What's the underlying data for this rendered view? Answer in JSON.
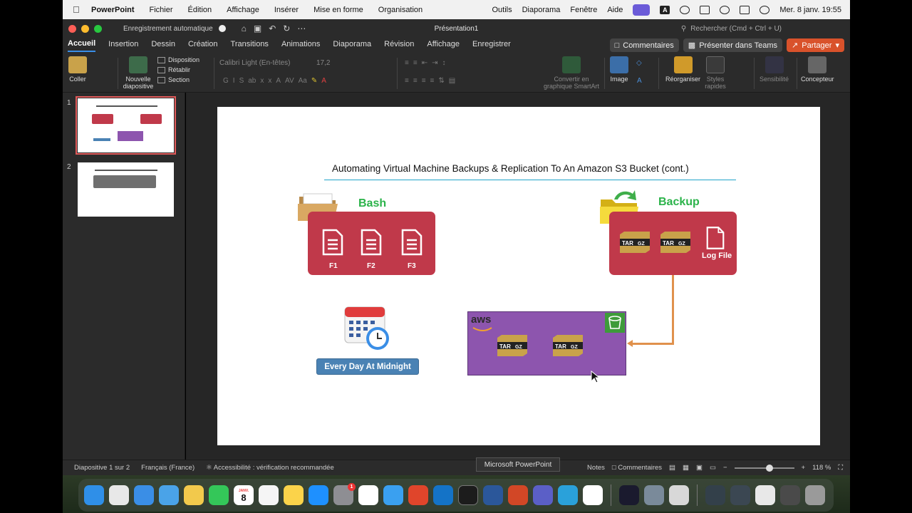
{
  "menubar": {
    "app": "PowerPoint",
    "items": [
      "Fichier",
      "Édition",
      "Affichage",
      "Insérer",
      "Mise en forme",
      "Organisation",
      "Outils",
      "Diaporama",
      "Fenêtre",
      "Aide"
    ],
    "clock": "Mer. 8 janv. 19:55"
  },
  "titlebar": {
    "autosave": "Enregistrement automatique",
    "title": "Présentation1",
    "search_placeholder": "Rechercher (Cmd + Ctrl + U)"
  },
  "tabs": [
    "Accueil",
    "Insertion",
    "Dessin",
    "Création",
    "Transitions",
    "Animations",
    "Diaporama",
    "Révision",
    "Affichage",
    "Enregistrer"
  ],
  "active_tab": "Accueil",
  "buttons": {
    "comments": "Commentaires",
    "teams": "Présenter dans Teams",
    "share": "Partager"
  },
  "ribbon": {
    "paste": "Coller",
    "new_slide": "Nouvelle diapositive",
    "layout": "Disposition",
    "reset": "Rétablir",
    "section": "Section",
    "font": "Calibri Light (En-têtes)",
    "size": "17,2",
    "smartart": "Convertir en graphique SmartArt",
    "image": "Image",
    "arrange": "Réorganiser",
    "quick_styles": "Styles rapides",
    "sensitivity": "Sensibilité",
    "designer": "Concepteur"
  },
  "thumbnails": [
    "1",
    "2"
  ],
  "slide": {
    "title": "Automating Virtual Machine Backups & Replication To An Amazon S3 Bucket (cont.)",
    "bash_label": "Bash",
    "files": [
      "F1",
      "F2",
      "F3"
    ],
    "backup_label": "Backup",
    "tar_text": "TAR",
    "gz_text": "GZ",
    "log_file": "Log File",
    "aws": "aws",
    "schedule": "Every Day At Midnight",
    "calendar_month": "JANV.",
    "calendar_day": "8"
  },
  "statusbar": {
    "slide_info": "Diapositive 1 sur 2",
    "language": "Français (France)",
    "accessibility": "Accessibilité : vérification recommandée",
    "notes": "Notes",
    "comments": "Commentaires",
    "zoom": "118 %",
    "tooltip": "Microsoft PowerPoint"
  },
  "dock_badge": "1",
  "colors": {
    "red_box": "#c0394a",
    "aws_box": "#8d55ae",
    "green_heading": "#2bb34a",
    "arrow": "#e0914c",
    "schedule_button": "#4a82b4"
  }
}
